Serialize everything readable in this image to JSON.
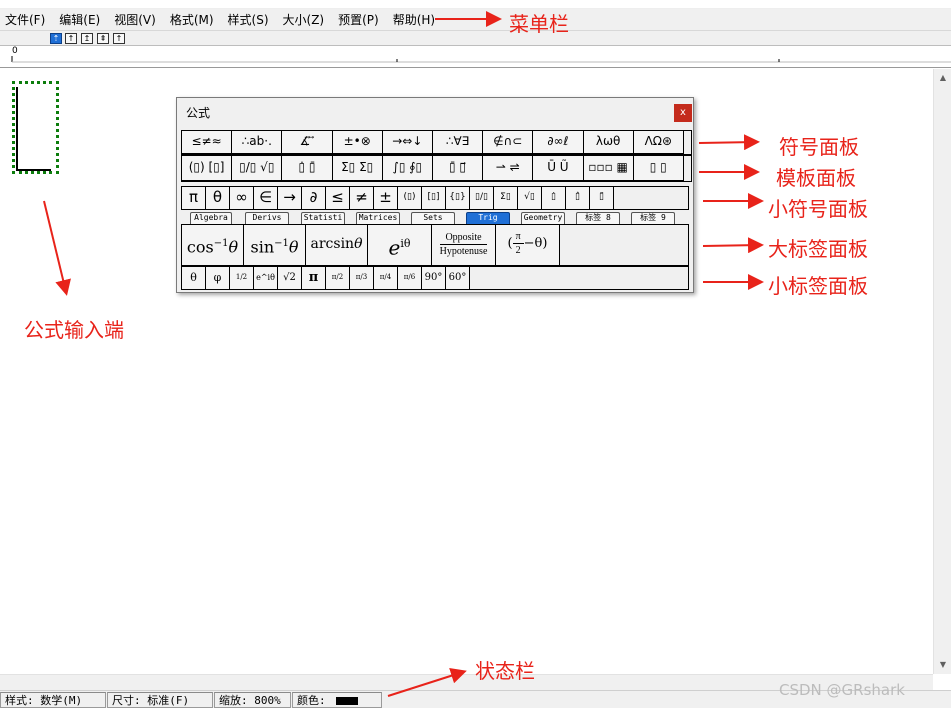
{
  "menu": [
    "文件(F)",
    "编辑(E)",
    "视图(V)",
    "格式(M)",
    "样式(S)",
    "大小(Z)",
    "预置(P)",
    "帮助(H)"
  ],
  "toolbar_buttons": [
    "⇡",
    "↑",
    "↥",
    "⇞",
    "↑"
  ],
  "ruler_zero": "0",
  "palette": {
    "title": "公式",
    "close": "x",
    "symbol_panel": [
      "≤≠≈",
      "∴ab·.",
      "∡⃗ ⃗",
      "±•⊗",
      "→⇔↓",
      "∴∀∃",
      "∉∩⊂",
      "∂∞ℓ",
      "λωθ",
      "ΛΩ⊛"
    ],
    "template_panel": [
      "(▯) [▯]",
      "▯/▯ √▯",
      "▯̇ ▯̄",
      "Σ▯ Σ▯",
      "∫▯ ∮▯",
      "▯̄ ▯⃗",
      "⇀ ⇌",
      "Ū Ũ",
      "▫▫▫ ▦",
      "▯ ▯"
    ],
    "small_symbols": [
      "π",
      "θ",
      "∞",
      "∈",
      "→",
      "∂",
      "≤",
      "≠",
      "±",
      "(▯)",
      "[▯]",
      "{▯}",
      "▯/▯",
      "Σ▯",
      "√▯",
      "▯̇",
      "▯̂",
      "▯̃"
    ],
    "tabs": [
      "Algebra",
      "Derivs",
      "Statisti",
      "Matrices",
      "Sets",
      "Trig",
      "Geometry",
      "标签 8",
      "标签 9"
    ],
    "active_tab": "Trig",
    "big_labels": {
      "acos": "cos",
      "acos_sup": "−1",
      "acos_arg": "θ",
      "asin": "sin",
      "asin_sup": "−1",
      "asin_arg": "θ",
      "arcsin": "arcsin",
      "arcsin_arg": "θ",
      "euler": "e",
      "euler_sup": "iθ",
      "ratio_num": "Opposite",
      "ratio_den": "Hypotenuse",
      "comp_num": "π",
      "comp_den": "2",
      "comp_rest": "−θ"
    },
    "small_labels": [
      "θ",
      "φ",
      "1/2",
      "e^iθ",
      "√2",
      "π",
      "π/2",
      "π/3",
      "π/4",
      "π/6",
      "90°",
      "60°"
    ]
  },
  "status": {
    "style": "样式: 数学(M)",
    "size": "尺寸: 标准(F)",
    "zoom": "缩放: 800%",
    "color_label": "颜色:",
    "color_value": "#000000"
  },
  "annotations": {
    "menubar": "菜单栏",
    "symbol_panel": "符号面板",
    "template_panel": "模板面板",
    "small_symbol_panel": "小符号面板",
    "big_label_panel": "大标签面板",
    "small_label_panel": "小标签面板",
    "formula_input": "公式输入端",
    "statusbar": "状态栏"
  },
  "watermark": "CSDN @GRshark",
  "annotation_color": "#e8231a"
}
